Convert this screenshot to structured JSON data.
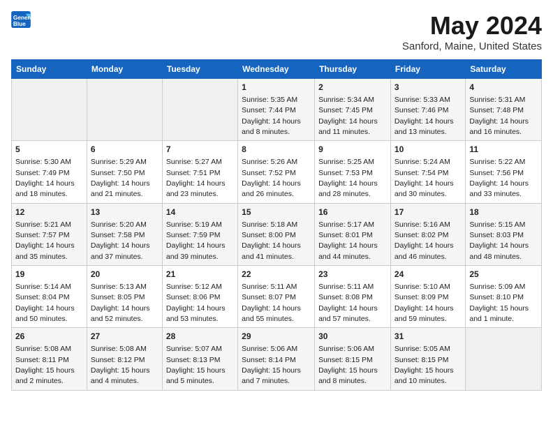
{
  "logo": {
    "line1": "General",
    "line2": "Blue"
  },
  "title": "May 2024",
  "subtitle": "Sanford, Maine, United States",
  "days_of_week": [
    "Sunday",
    "Monday",
    "Tuesday",
    "Wednesday",
    "Thursday",
    "Friday",
    "Saturday"
  ],
  "weeks": [
    [
      {
        "num": "",
        "detail": ""
      },
      {
        "num": "",
        "detail": ""
      },
      {
        "num": "",
        "detail": ""
      },
      {
        "num": "1",
        "detail": "Sunrise: 5:35 AM\nSunset: 7:44 PM\nDaylight: 14 hours\nand 8 minutes."
      },
      {
        "num": "2",
        "detail": "Sunrise: 5:34 AM\nSunset: 7:45 PM\nDaylight: 14 hours\nand 11 minutes."
      },
      {
        "num": "3",
        "detail": "Sunrise: 5:33 AM\nSunset: 7:46 PM\nDaylight: 14 hours\nand 13 minutes."
      },
      {
        "num": "4",
        "detail": "Sunrise: 5:31 AM\nSunset: 7:48 PM\nDaylight: 14 hours\nand 16 minutes."
      }
    ],
    [
      {
        "num": "5",
        "detail": "Sunrise: 5:30 AM\nSunset: 7:49 PM\nDaylight: 14 hours\nand 18 minutes."
      },
      {
        "num": "6",
        "detail": "Sunrise: 5:29 AM\nSunset: 7:50 PM\nDaylight: 14 hours\nand 21 minutes."
      },
      {
        "num": "7",
        "detail": "Sunrise: 5:27 AM\nSunset: 7:51 PM\nDaylight: 14 hours\nand 23 minutes."
      },
      {
        "num": "8",
        "detail": "Sunrise: 5:26 AM\nSunset: 7:52 PM\nDaylight: 14 hours\nand 26 minutes."
      },
      {
        "num": "9",
        "detail": "Sunrise: 5:25 AM\nSunset: 7:53 PM\nDaylight: 14 hours\nand 28 minutes."
      },
      {
        "num": "10",
        "detail": "Sunrise: 5:24 AM\nSunset: 7:54 PM\nDaylight: 14 hours\nand 30 minutes."
      },
      {
        "num": "11",
        "detail": "Sunrise: 5:22 AM\nSunset: 7:56 PM\nDaylight: 14 hours\nand 33 minutes."
      }
    ],
    [
      {
        "num": "12",
        "detail": "Sunrise: 5:21 AM\nSunset: 7:57 PM\nDaylight: 14 hours\nand 35 minutes."
      },
      {
        "num": "13",
        "detail": "Sunrise: 5:20 AM\nSunset: 7:58 PM\nDaylight: 14 hours\nand 37 minutes."
      },
      {
        "num": "14",
        "detail": "Sunrise: 5:19 AM\nSunset: 7:59 PM\nDaylight: 14 hours\nand 39 minutes."
      },
      {
        "num": "15",
        "detail": "Sunrise: 5:18 AM\nSunset: 8:00 PM\nDaylight: 14 hours\nand 41 minutes."
      },
      {
        "num": "16",
        "detail": "Sunrise: 5:17 AM\nSunset: 8:01 PM\nDaylight: 14 hours\nand 44 minutes."
      },
      {
        "num": "17",
        "detail": "Sunrise: 5:16 AM\nSunset: 8:02 PM\nDaylight: 14 hours\nand 46 minutes."
      },
      {
        "num": "18",
        "detail": "Sunrise: 5:15 AM\nSunset: 8:03 PM\nDaylight: 14 hours\nand 48 minutes."
      }
    ],
    [
      {
        "num": "19",
        "detail": "Sunrise: 5:14 AM\nSunset: 8:04 PM\nDaylight: 14 hours\nand 50 minutes."
      },
      {
        "num": "20",
        "detail": "Sunrise: 5:13 AM\nSunset: 8:05 PM\nDaylight: 14 hours\nand 52 minutes."
      },
      {
        "num": "21",
        "detail": "Sunrise: 5:12 AM\nSunset: 8:06 PM\nDaylight: 14 hours\nand 53 minutes."
      },
      {
        "num": "22",
        "detail": "Sunrise: 5:11 AM\nSunset: 8:07 PM\nDaylight: 14 hours\nand 55 minutes."
      },
      {
        "num": "23",
        "detail": "Sunrise: 5:11 AM\nSunset: 8:08 PM\nDaylight: 14 hours\nand 57 minutes."
      },
      {
        "num": "24",
        "detail": "Sunrise: 5:10 AM\nSunset: 8:09 PM\nDaylight: 14 hours\nand 59 minutes."
      },
      {
        "num": "25",
        "detail": "Sunrise: 5:09 AM\nSunset: 8:10 PM\nDaylight: 15 hours\nand 1 minute."
      }
    ],
    [
      {
        "num": "26",
        "detail": "Sunrise: 5:08 AM\nSunset: 8:11 PM\nDaylight: 15 hours\nand 2 minutes."
      },
      {
        "num": "27",
        "detail": "Sunrise: 5:08 AM\nSunset: 8:12 PM\nDaylight: 15 hours\nand 4 minutes."
      },
      {
        "num": "28",
        "detail": "Sunrise: 5:07 AM\nSunset: 8:13 PM\nDaylight: 15 hours\nand 5 minutes."
      },
      {
        "num": "29",
        "detail": "Sunrise: 5:06 AM\nSunset: 8:14 PM\nDaylight: 15 hours\nand 7 minutes."
      },
      {
        "num": "30",
        "detail": "Sunrise: 5:06 AM\nSunset: 8:15 PM\nDaylight: 15 hours\nand 8 minutes."
      },
      {
        "num": "31",
        "detail": "Sunrise: 5:05 AM\nSunset: 8:15 PM\nDaylight: 15 hours\nand 10 minutes."
      },
      {
        "num": "",
        "detail": ""
      }
    ]
  ]
}
